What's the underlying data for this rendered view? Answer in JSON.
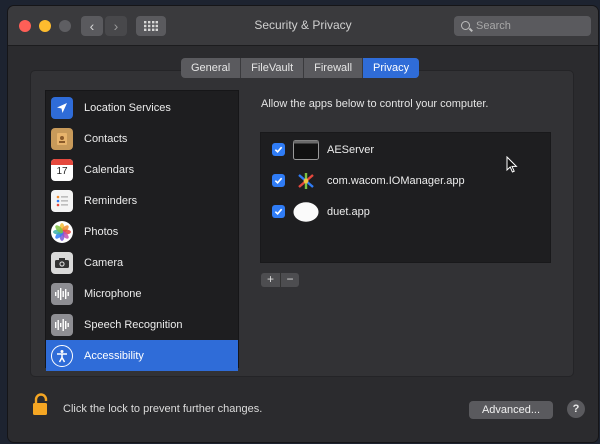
{
  "window": {
    "title": "Security & Privacy",
    "search_placeholder": "Search"
  },
  "nav": {
    "back": "‹",
    "forward": "›"
  },
  "tabs": [
    {
      "label": "General",
      "active": false
    },
    {
      "label": "FileVault",
      "active": false
    },
    {
      "label": "Firewall",
      "active": false
    },
    {
      "label": "Privacy",
      "active": true
    }
  ],
  "sidebar": {
    "selected": "Accessibility",
    "items": [
      {
        "label": "Location Services",
        "icon": "location-arrow-icon"
      },
      {
        "label": "Contacts",
        "icon": "contacts-book-icon"
      },
      {
        "label": "Calendars",
        "icon": "calendar-icon",
        "icon_text": "17"
      },
      {
        "label": "Reminders",
        "icon": "reminders-list-icon"
      },
      {
        "label": "Photos",
        "icon": "photos-flower-icon"
      },
      {
        "label": "Camera",
        "icon": "camera-icon"
      },
      {
        "label": "Microphone",
        "icon": "waveform-icon"
      },
      {
        "label": "Speech Recognition",
        "icon": "speech-waveform-icon"
      },
      {
        "label": "Accessibility",
        "icon": "accessibility-person-icon"
      }
    ]
  },
  "main": {
    "heading": "Allow the apps below to control your computer.",
    "apps": [
      {
        "name": "AEServer",
        "checked": true,
        "icon": "terminal-app-icon"
      },
      {
        "name": "com.wacom.IOManager.app",
        "checked": true,
        "icon": "wacom-app-icon"
      },
      {
        "name": "duet.app",
        "checked": true,
        "icon": "duet-app-icon"
      }
    ],
    "add_label": "+",
    "remove_label": "−"
  },
  "footer": {
    "lock_text": "Click the lock to prevent further changes.",
    "advanced_label": "Advanced...",
    "help_label": "?"
  },
  "colors": {
    "accent": "#2f6cd8",
    "checkbox": "#2f7cf6",
    "window_bg": "#2b2b2e",
    "list_bg": "#1e1e20",
    "lock": "#f5a623"
  }
}
